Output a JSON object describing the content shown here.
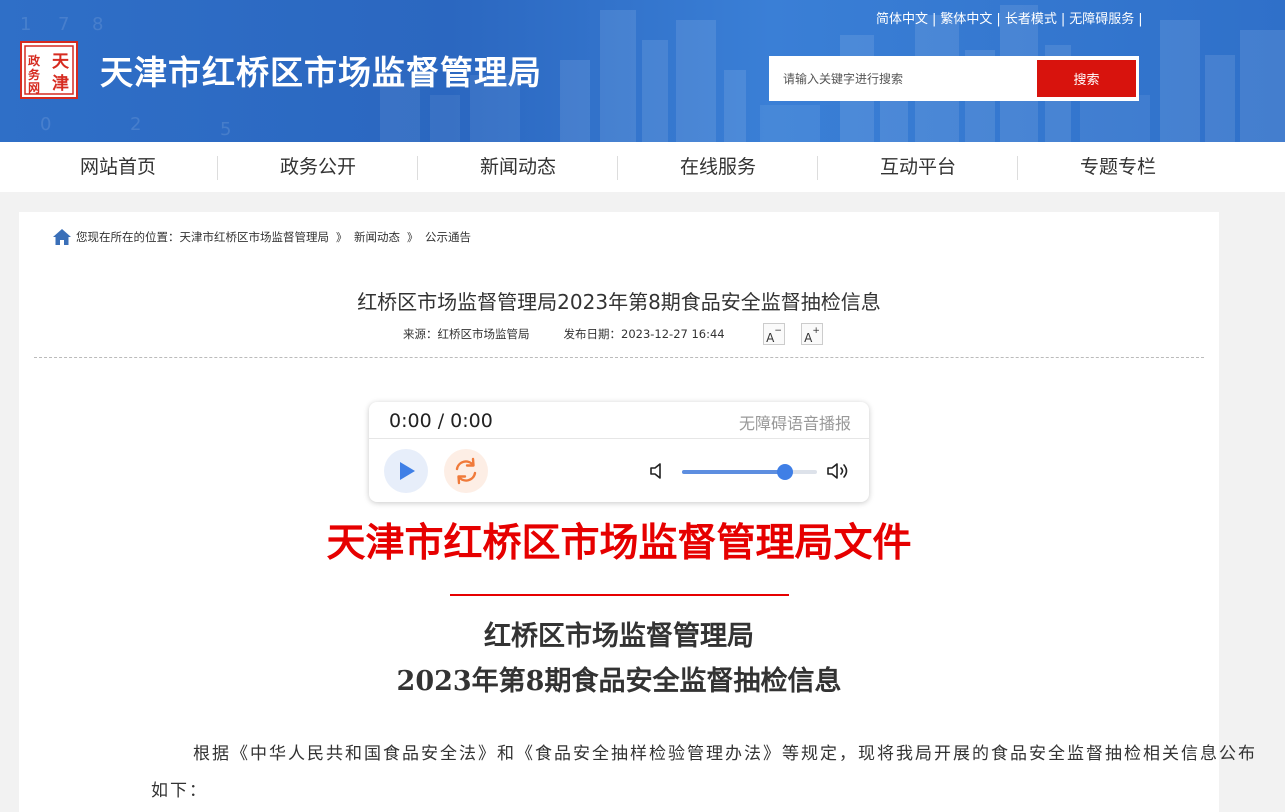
{
  "header": {
    "site_title": "天津市红桥区市场监督管理局",
    "logo_text": [
      "天津",
      "政务",
      "网"
    ],
    "top_links": [
      "简体中文",
      "繁体中文",
      "长者模式",
      "无障碍服务"
    ],
    "search": {
      "placeholder": "请输入关键字进行搜索",
      "button_label": "搜索"
    }
  },
  "nav": {
    "items": [
      "网站首页",
      "政务公开",
      "新闻动态",
      "在线服务",
      "互动平台",
      "专题专栏"
    ]
  },
  "breadcrumb": {
    "prefix": "您现在所在的位置：",
    "items": [
      "天津市红桥区市场监督管理局",
      "新闻动态",
      "公示通告"
    ],
    "separator": "》"
  },
  "article": {
    "title": "红桥区市场监督管理局2023年第8期食品安全监督抽检信息",
    "source": "来源：红桥区市场监管局",
    "date": "发布日期：2023-12-27 16:44",
    "font_decrease": "A",
    "font_increase": "A"
  },
  "player": {
    "time": "0:00 / 0:00",
    "label": "无障碍语音播报",
    "volume": 0.76
  },
  "document": {
    "heading": "天津市红桥区市场监督管理局文件",
    "subtitle_line1": "红桥区市场监督管理局",
    "subtitle_line2": "2023年第8期食品安全监督抽检信息",
    "paragraph": "根据《中华人民共和国食品安全法》和《食品安全抽样检验管理办法》等规定，现将我局开展的食品安全监督抽检相关信息公布如下："
  },
  "colors": {
    "header_blue": "#2f6fc7",
    "search_red": "#d8130d",
    "doc_red": "#e60000",
    "player_blue": "#3f7fe6"
  }
}
